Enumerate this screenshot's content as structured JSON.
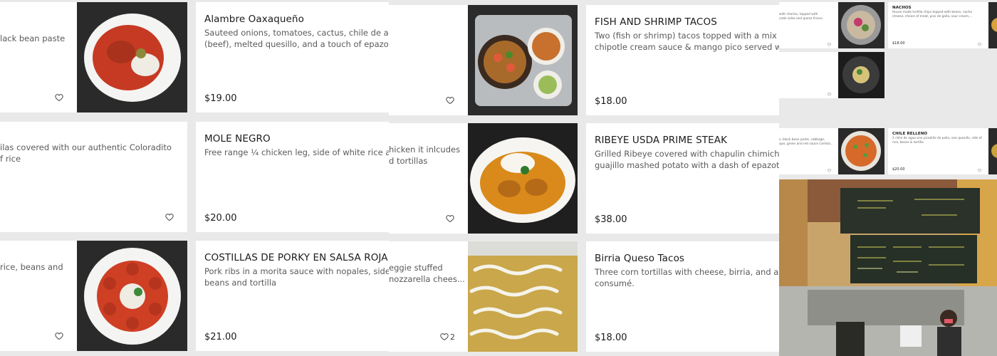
{
  "panel1": {
    "left_cards": [
      {
        "desc": "lack bean paste"
      },
      {
        "desc": "ilas covered with our authentic Coloradito\nf rice"
      },
      {
        "desc": "rice, beans and"
      }
    ],
    "right_cards": [
      {
        "title": "Alambre Oaxaqueño",
        "desc": "Sauteed onions, tomatoes, cactus, chile de agua, t\n(beef), melted quesillo, and a touch of epazote.",
        "price": "$19.00"
      },
      {
        "title": "MOLE NEGRO",
        "desc": "Free range ¼ chicken leg, side of white rice and to",
        "price": "$20.00"
      },
      {
        "title": "COSTILLAS DE PORKY EN SALSA ROJA",
        "desc": "Pork ribs in a morita sauce with nopales, side of bl\nbeans and tortilla",
        "price": "$21.00"
      }
    ]
  },
  "panel2": {
    "left_cards": [
      {
        "desc": "",
        "likes": ""
      },
      {
        "desc": "hicken it inlcudes\nd tortillas",
        "likes": ""
      },
      {
        "desc": "eggie stuffed\nnozzarella chees...",
        "likes": "2"
      }
    ],
    "right_cards": [
      {
        "title": "FISH AND SHRIMP TACOS",
        "desc": "Two (fish or shrimp) tacos topped with a mix of cal\nchipotle cream sauce & mango pico served with ric",
        "price": "$18.00"
      },
      {
        "title": "RIBEYE USDA PRIME STEAK",
        "desc": "Grilled Ribeye covered with chapulin chimichurri, s\nguajillo mashed potato with a dash of epazote",
        "price": "$38.00"
      },
      {
        "title": "Birria Queso Tacos",
        "desc": "Three corn tortillas with cheese, birria, and a side c\nconsumé.",
        "price": "$18.00"
      }
    ]
  },
  "panel3": {
    "row1_left_desc": "with chorizo, topped with\ncado salsa and queso fresco",
    "nachos": {
      "title": "NACHOS",
      "desc": "House made tortilla chips topped with beans, nacho\ncheese, choice of meat, pico de gallo, sour cream,...",
      "price": "$18.00"
    },
    "row3_left_desc": "s, black bean paste, cabbage,\nque, green and red sauce Cemita...",
    "chile_relleno": {
      "title": "CHILE RELLENO",
      "desc": "2 chile de agua one picadillo de pollo, one quesillo, side of\nrice, beans & tortilla",
      "price": "$20.00"
    }
  },
  "colors": {
    "background": "#e9e9e9",
    "card": "#ffffff",
    "text": "#1b1b1b",
    "muted": "#5a5a5a"
  },
  "icons": [
    "heart-icon"
  ]
}
